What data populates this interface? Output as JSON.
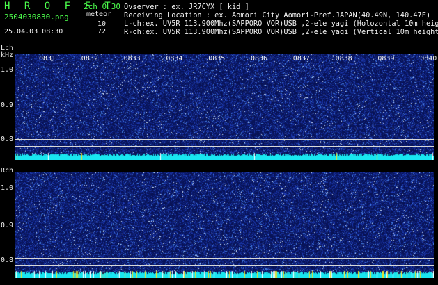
{
  "header": {
    "app_title": "H R O F F T",
    "mode": "2ch 0.30",
    "file_name": "2504030830.png",
    "meteor_label": "meteor",
    "date_time": "25.04.03 08:30",
    "lch_count": "10",
    "rch_count": "72"
  },
  "info": {
    "observer": "Ovserver               : ex. JR7CYX [ kid ]",
    "location": "Receiving Location : ex. Aomori City Aomori-Pref.JAPAN(40.49N, 140.47E)",
    "lch": "L-ch:ex. UV5R 113.900Mhz(SAPPORO VOR)USB ,2-ele yagi (Holozontal 10m height)",
    "rch": "R-ch:ex. UV5R 113.900Mhz(SAPPORO VOR)USB ,2-ele yagi (Vertical 10m height)"
  },
  "panels": {
    "lch_label": "Lch",
    "khz_label": "kHz",
    "rch_label": "Rch",
    "y_ticks": [
      "1.0",
      "0.9",
      "0.8"
    ],
    "time_ticks": [
      "0831",
      "0832",
      "0833",
      "0834",
      "0835",
      "0836",
      "0837",
      "0838",
      "0839",
      "0840"
    ]
  },
  "colors": {
    "background": "#000000",
    "header_green": "#4cff4c",
    "spectrogram_base": "#0a1670",
    "noise_floor": "#19e6f0",
    "meteor_spike": "#f0e020"
  }
}
